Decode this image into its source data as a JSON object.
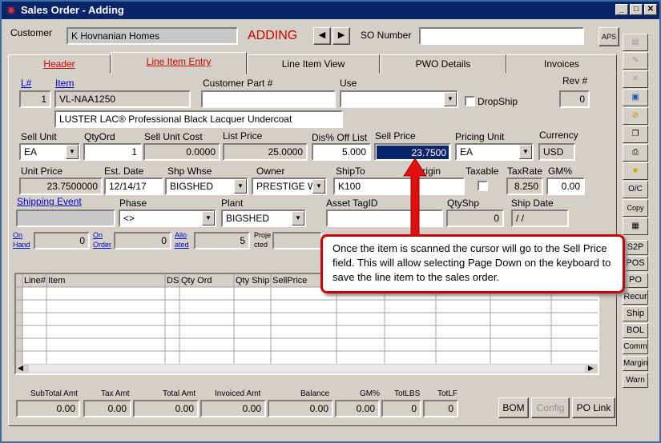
{
  "window": {
    "title": "Sales Order - Adding"
  },
  "header": {
    "customer_label": "Customer",
    "customer_value": "K Hovnanian Homes",
    "mode": "ADDING",
    "so_number_label": "SO Number",
    "so_number_value": "",
    "aps_label": "APS"
  },
  "tabs": [
    {
      "label": "Header"
    },
    {
      "label": "Line Item Entry"
    },
    {
      "label": "Line Item View"
    },
    {
      "label": "PWO Details"
    },
    {
      "label": "Invoices"
    }
  ],
  "line": {
    "line_num_label": "L#",
    "line_num": "1",
    "item_label": "Item",
    "item": "VL-NAA1250",
    "customer_part_label": "Customer Part #",
    "customer_part": "",
    "use_label": "Use",
    "use": "",
    "dropship_label": "DropShip",
    "rev_label": "Rev #",
    "rev": "0",
    "description": "LUSTER LAC® Professional Black Lacquer Undercoat",
    "sell_unit_label": "Sell Unit",
    "sell_unit": "EA",
    "qty_ord_label": "QtyOrd",
    "qty_ord": "1",
    "sell_unit_cost_label": "Sell Unit Cost",
    "sell_unit_cost": "0.0000",
    "list_price_label": "List Price",
    "list_price": "25.0000",
    "dis_off_label": "Dis% Off List",
    "dis_off": "5.000",
    "sell_price_label": "Sell Price",
    "sell_price": "23.7500",
    "pricing_unit_label": "Pricing Unit",
    "pricing_unit": "EA",
    "currency_label": "Currency",
    "currency": "USD",
    "unit_price_label": "Unit Price",
    "unit_price": "23.7500000",
    "est_date_label": "Est. Date",
    "est_date": "12/14/17",
    "shp_whse_label": "Shp Whse",
    "shp_whse": "BIGSHED",
    "owner_label": "Owner",
    "owner": "PRESTIGE W",
    "ship_to_label": "ShipTo",
    "ship_to": "K100",
    "origin_label": "Origin",
    "taxable_label": "Taxable",
    "tax_rate_label": "TaxRate",
    "tax_rate": "8.250",
    "gm_label": "GM%",
    "gm": "0.00",
    "shipping_event_label": "Shipping Event",
    "phase_label": "Phase",
    "phase": "<>",
    "plant_label": "Plant",
    "plant": "BIGSHED",
    "asset_tag_label": "Asset TagID",
    "qty_shp_label": "QtyShp",
    "qty_shp": "0",
    "ship_date_label": "Ship Date",
    "ship_date": "/ /",
    "on_hand_label1": "On",
    "on_hand_label2": "Hand",
    "on_hand": "0",
    "on_order_label1": "On",
    "on_order_label2": "Order",
    "on_order": "0",
    "allocated_label1": "Allo",
    "allocated_label2": "ated",
    "allocated": "5",
    "projected_label1": "Proje",
    "projected_label2": "cted"
  },
  "grid": {
    "columns": [
      "Line#",
      "Item",
      "DS",
      "Qty Ord",
      "Qty Ship",
      "SellPrice"
    ]
  },
  "totals": [
    {
      "label": "SubTotal Amt",
      "value": "0.00"
    },
    {
      "label": "Tax Amt",
      "value": "0.00"
    },
    {
      "label": "Total Amt",
      "value": "0.00"
    },
    {
      "label": "Invoiced Amt",
      "value": "0.00"
    },
    {
      "label": "Balance",
      "value": "0.00"
    },
    {
      "label": "GM%",
      "value": "0.00"
    },
    {
      "label": "TotLBS",
      "value": "0"
    },
    {
      "label": "TotLF",
      "value": "0"
    }
  ],
  "bottom_buttons": {
    "bom": "BOM",
    "config": "Config",
    "po_link": "PO Link"
  },
  "side_buttons": {
    "oc": "O/C",
    "copy": "Copy"
  },
  "side_buttons2": [
    "S2P",
    "POS",
    "PO",
    "Recur",
    "Ship",
    "BOL",
    "Comm",
    "Margin",
    "Warn"
  ],
  "callout": "Once the item is scanned the cursor will go to the Sell Price field.  This will allow selecting Page Down on the keyboard to save the line item to the sales order.",
  "colors": {
    "accent_red": "#cc0000",
    "title_blue": "#0a246a",
    "selection": "#0a246a"
  }
}
